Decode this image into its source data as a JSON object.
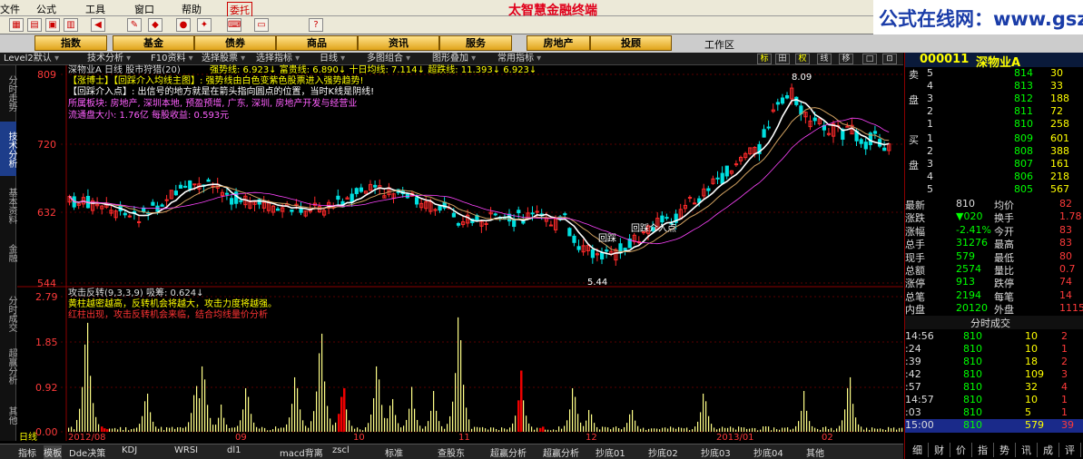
{
  "menu": [
    "文件",
    "公式",
    "工具",
    "窗口",
    "帮助",
    "委托"
  ],
  "banner": "太智慧金融终端",
  "watermark": "公式在线网：www.gszx.com.cn",
  "nav": [
    "指数",
    "基金",
    "债券",
    "商品",
    "资讯",
    "服务",
    "房地产",
    "投顾"
  ],
  "workzone": "工作区",
  "subtoolbar": [
    "Level2默认",
    "技术分析",
    "F10资料",
    "选择股票",
    "选择指标",
    "日线",
    "多图组合",
    "图形叠加",
    "常用指标"
  ],
  "right_buttons": [
    "标",
    "田",
    "权",
    "线",
    "移",
    "□",
    "⊡"
  ],
  "left_tabs": [
    "分时走势",
    "技术分析",
    "基本资料",
    "金融",
    "分时成交",
    "超赢分析",
    "其他"
  ],
  "kline": {
    "title": "深物业A  日线 股市狩猎(20)",
    "indicator_line": "强势线: 6.923↓  富贵线: 6.890↓  十日均线: 7.114↓  超跌线: 11.393↓  6.923↓",
    "note1": "【涨博士】【回踩介入均线主图】: 强势线由白色变紫色股票进入强势趋势!",
    "note2": "【回踩介入点】: 出信号的地方就是在箭头指向圆点的位置，当时K线是阴线!",
    "sector": "所属板块: 房地产, 深圳本地, 预盈预增, 广东, 深圳, 房地产开发与经营业",
    "cap": "流通盘大小: 1.76亿  每股收益: 0.593元",
    "yticks": [
      "809",
      "720",
      "632",
      "544"
    ],
    "high_label": "8.09",
    "low_label": "5.44",
    "signal_label": "回踩介入点",
    "signal_label2": "回踩"
  },
  "osc": {
    "title": "攻击反转(9,3,3,9) 吸筹: 0.624↓",
    "note1": "黄柱越密越高，反转机会将越大，攻击力度将越强。",
    "note2": "红柱出现，攻击反转机会来临，结合均线量价分析",
    "yticks": [
      "2.79",
      "1.85",
      "0.92",
      "0.00"
    ],
    "dates": [
      "2012/08",
      "09",
      "10",
      "11",
      "12",
      "2013/01",
      "02"
    ],
    "period": "日线"
  },
  "stock": {
    "code": "000011",
    "name": "深物业A",
    "sell": [
      [
        "卖",
        "5",
        "814",
        "30"
      ],
      [
        "",
        "4",
        "813",
        "33"
      ],
      [
        "盘",
        "3",
        "812",
        "188"
      ],
      [
        "",
        "2",
        "811",
        "72"
      ],
      [
        "",
        "1",
        "810",
        "258"
      ]
    ],
    "buy": [
      [
        "买",
        "1",
        "809",
        "601"
      ],
      [
        "",
        "2",
        "808",
        "388"
      ],
      [
        "盘",
        "3",
        "807",
        "161"
      ],
      [
        "",
        "4",
        "806",
        "218"
      ],
      [
        "",
        "5",
        "805",
        "567"
      ]
    ],
    "stats": [
      [
        "最新",
        "810",
        "均价",
        "82"
      ],
      [
        "涨跌",
        "▼020",
        "换手",
        "1.78"
      ],
      [
        "涨幅",
        "-2.41%",
        "今开",
        "83"
      ],
      [
        "总手",
        "31276",
        "最高",
        "83"
      ],
      [
        "现手",
        "579",
        "最低",
        "80"
      ],
      [
        "总额",
        "2574",
        "量比",
        "0.7"
      ],
      [
        "涨停",
        "913",
        "跌停",
        "74"
      ],
      [
        "总笔",
        "2194",
        "每笔",
        "14"
      ],
      [
        "内盘",
        "20120",
        "外盘",
        "1115"
      ]
    ],
    "ticks_title": "分时成交",
    "ticks": [
      [
        "14:56",
        "810",
        "10",
        "2"
      ],
      [
        ":24",
        "810",
        "10",
        "1"
      ],
      [
        ":39",
        "810",
        "18",
        "2"
      ],
      [
        ":42",
        "810",
        "109",
        "3"
      ],
      [
        ":57",
        "810",
        "32",
        "4"
      ],
      [
        "14:57",
        "810",
        "10",
        "1"
      ],
      [
        ":03",
        "810",
        "5",
        "1"
      ],
      [
        "15:00",
        "810",
        "579",
        "39"
      ]
    ],
    "bottom_tabs": [
      "细",
      "财",
      "价",
      "指",
      "势",
      "讯",
      "成",
      "评"
    ]
  },
  "bottom": [
    "指标",
    "模板",
    "Dde决策",
    "KDJ",
    "WRSI",
    "dl1",
    "macd背离",
    "zscl",
    "标准",
    "查股东",
    "超赢分析",
    "超赢分析",
    "抄底01",
    "抄底02",
    "抄底03",
    "抄底04",
    "其他"
  ],
  "colors": {
    "up": "#ff2a2a",
    "down": "#00e0e0",
    "yellow": "#ffff00",
    "magenta": "#ff00ff"
  }
}
